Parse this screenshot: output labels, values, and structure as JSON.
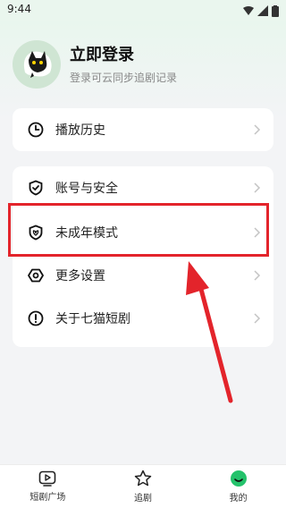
{
  "status_bar": {
    "time": "9:44"
  },
  "profile": {
    "title": "立即登录",
    "subtitle": "登录可云同步追剧记录"
  },
  "menu_group_1": [
    {
      "label": "播放历史",
      "icon": "clock-icon"
    }
  ],
  "menu_group_2": [
    {
      "label": "账号与安全",
      "icon": "shield-check-icon"
    },
    {
      "label": "未成年模式",
      "icon": "shield-leaf-icon"
    },
    {
      "label": "更多设置",
      "icon": "hexagon-settings-icon"
    },
    {
      "label": "关于七猫短剧",
      "icon": "info-icon"
    }
  ],
  "bottom_nav": [
    {
      "label": "短剧广场",
      "icon": "play-square-icon"
    },
    {
      "label": "追剧",
      "icon": "star-icon"
    },
    {
      "label": "我的",
      "icon": "smile-face-icon"
    }
  ],
  "colors": {
    "accent_green": "#24c26b",
    "highlight_red": "#e3242b"
  }
}
